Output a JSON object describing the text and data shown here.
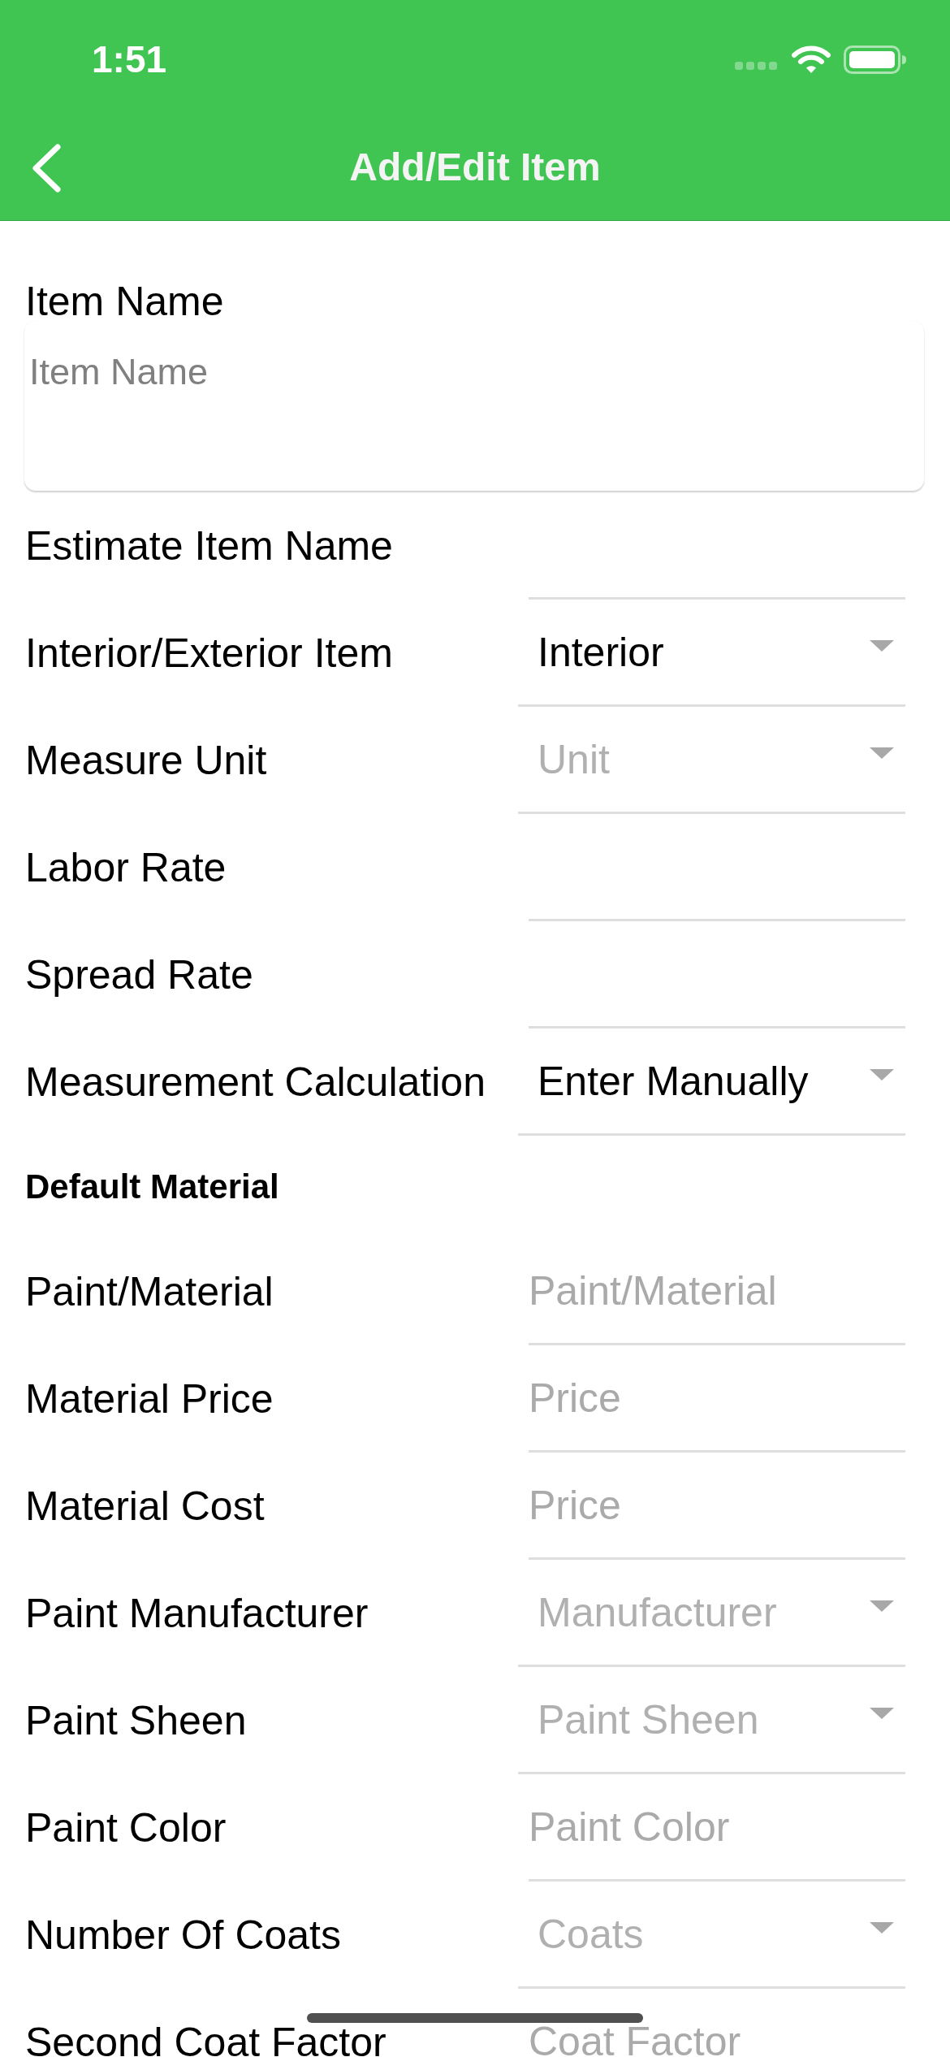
{
  "status_bar": {
    "time": "1:51"
  },
  "nav_bar": {
    "title": "Add/Edit Item"
  },
  "item_name": {
    "label": "Item Name",
    "placeholder": "Item Name"
  },
  "fields": [
    {
      "kind": "text",
      "label": "Estimate Item Name"
    },
    {
      "kind": "dropdown",
      "label": "Interior/Exterior Item",
      "value": "Interior"
    },
    {
      "kind": "dropdown",
      "label": "Measure Unit",
      "placeholder": "Unit"
    },
    {
      "kind": "text",
      "label": "Labor Rate"
    },
    {
      "kind": "text",
      "label": "Spread Rate"
    },
    {
      "kind": "dropdown",
      "label": "Measurement Calculation",
      "value": "Enter Manually"
    }
  ],
  "default_material": {
    "heading": "Default Material",
    "fields": [
      {
        "kind": "text",
        "label": "Paint/Material",
        "placeholder": "Paint/Material"
      },
      {
        "kind": "text",
        "label": "Material Price",
        "placeholder": "Price"
      },
      {
        "kind": "text",
        "label": "Material Cost",
        "placeholder": "Price"
      },
      {
        "kind": "dropdown",
        "label": "Paint Manufacturer",
        "placeholder": "Manufacturer"
      },
      {
        "kind": "dropdown",
        "label": "Paint Sheen",
        "placeholder": "Paint Sheen"
      },
      {
        "kind": "text",
        "label": "Paint Color",
        "placeholder": "Paint Color"
      },
      {
        "kind": "dropdown",
        "label": "Number Of Coats",
        "placeholder": "Coats"
      },
      {
        "kind": "text",
        "label": "Second Coat Factor",
        "placeholder": "Coat Factor"
      }
    ]
  }
}
